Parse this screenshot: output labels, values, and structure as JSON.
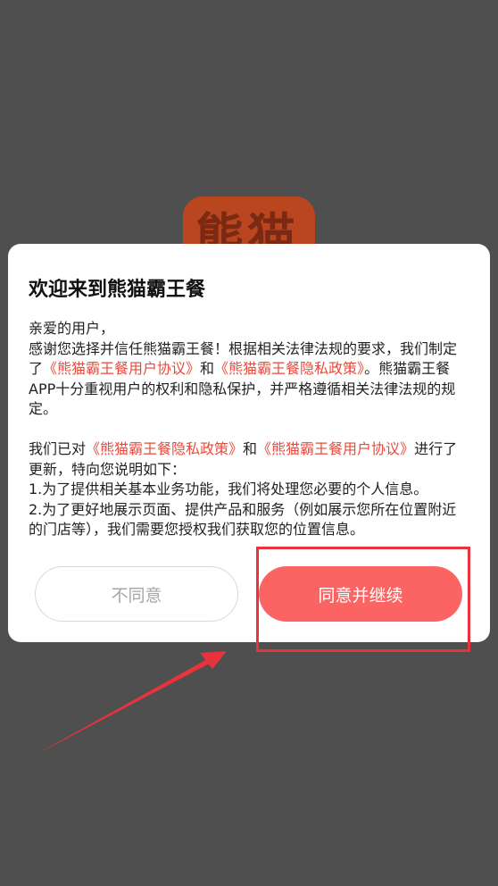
{
  "background": {
    "app_logo_text": "熊猫",
    "backdrop_color": "#4f4f4f",
    "logo_color": "#b9461f"
  },
  "dialog": {
    "title": "欢迎来到熊猫霸王餐",
    "greeting": "亲爱的用户，",
    "intro_1": "感谢您选择并信任熊猫霸王餐！根据相关法律法规的要求，我们制定了",
    "user_agreement_link": "《熊猫霸王餐用户协议》",
    "and_1": "和",
    "privacy_policy_link": "《熊猫霸王餐隐私政策》",
    "intro_2": "。熊猫霸王餐APP十分重视用户的权利和隐私保护，并严格遵循相关法律法规的规定。",
    "update_1": "我们已对",
    "privacy_policy_link_2": "《熊猫霸王餐隐私政策》",
    "and_2": "和",
    "user_agreement_link_2": "《熊猫霸王餐用户协议》",
    "update_2": "进行了更新，特向您说明如下：",
    "item_1": "1.为了提供相关基本业务功能，我们将处理您必要的个人信息。",
    "item_2": "2.为了更好地展示页面、提供产品和服务（例如展示您所在位置附近的门店等），我们需要您授权我们获取您的位置信息。",
    "disagree_label": "不同意",
    "agree_label": "同意并继续",
    "link_color": "#e84a3c",
    "agree_color": "#fb6463"
  },
  "annotation": {
    "highlight_color": "#e8323c",
    "arrow_icon": "red-arrow-icon"
  }
}
